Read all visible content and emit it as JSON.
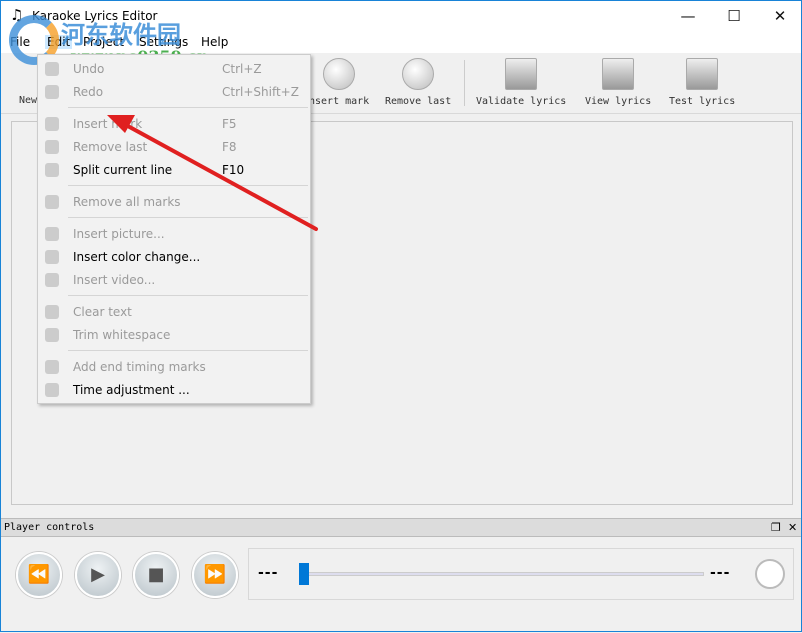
{
  "window": {
    "title": "Karaoke Lyrics Editor",
    "icon": "music-note-icon"
  },
  "menubar": [
    "File",
    "Edit",
    "Project",
    "Settings",
    "Help"
  ],
  "toolbar": [
    {
      "label": "New",
      "icon": "new-icon"
    },
    {
      "label": "Insert mark",
      "icon": "clock-plus-icon"
    },
    {
      "label": "Remove last",
      "icon": "clock-x-icon"
    },
    {
      "label": "Validate lyrics",
      "icon": "validate-icon"
    },
    {
      "label": "View lyrics",
      "icon": "view-icon"
    },
    {
      "label": "Test lyrics",
      "icon": "monitor-icon"
    }
  ],
  "toolbar_visible": {
    "new": "New",
    "insert": "nsert mark"
  },
  "edit_menu": [
    {
      "label": "Undo",
      "shortcut": "Ctrl+Z",
      "enabled": false
    },
    {
      "label": "Redo",
      "shortcut": "Ctrl+Shift+Z",
      "enabled": false
    },
    {
      "label": "Insert mark",
      "shortcut": "F5",
      "enabled": false
    },
    {
      "label": "Remove last",
      "shortcut": "F8",
      "enabled": false
    },
    {
      "label": "Split current line",
      "shortcut": "F10",
      "enabled": true
    },
    {
      "label": "Remove all marks",
      "shortcut": "",
      "enabled": false
    },
    {
      "label": "Insert picture...",
      "shortcut": "",
      "enabled": false
    },
    {
      "label": "Insert color change...",
      "shortcut": "",
      "enabled": true
    },
    {
      "label": "Insert video...",
      "shortcut": "",
      "enabled": false
    },
    {
      "label": "Clear text",
      "shortcut": "",
      "enabled": false
    },
    {
      "label": "Trim whitespace",
      "shortcut": "",
      "enabled": false
    },
    {
      "label": "Add end timing marks",
      "shortcut": "",
      "enabled": false
    },
    {
      "label": "Time adjustment ...",
      "shortcut": "",
      "enabled": true
    }
  ],
  "player": {
    "title": "Player controls",
    "start_time": "---",
    "end_time": "---",
    "position": 0
  },
  "watermark": {
    "text": "河东软件园",
    "url": "www.pc0359.cn"
  },
  "colors": {
    "accent": "#0078d7",
    "arrow": "#e02020"
  }
}
